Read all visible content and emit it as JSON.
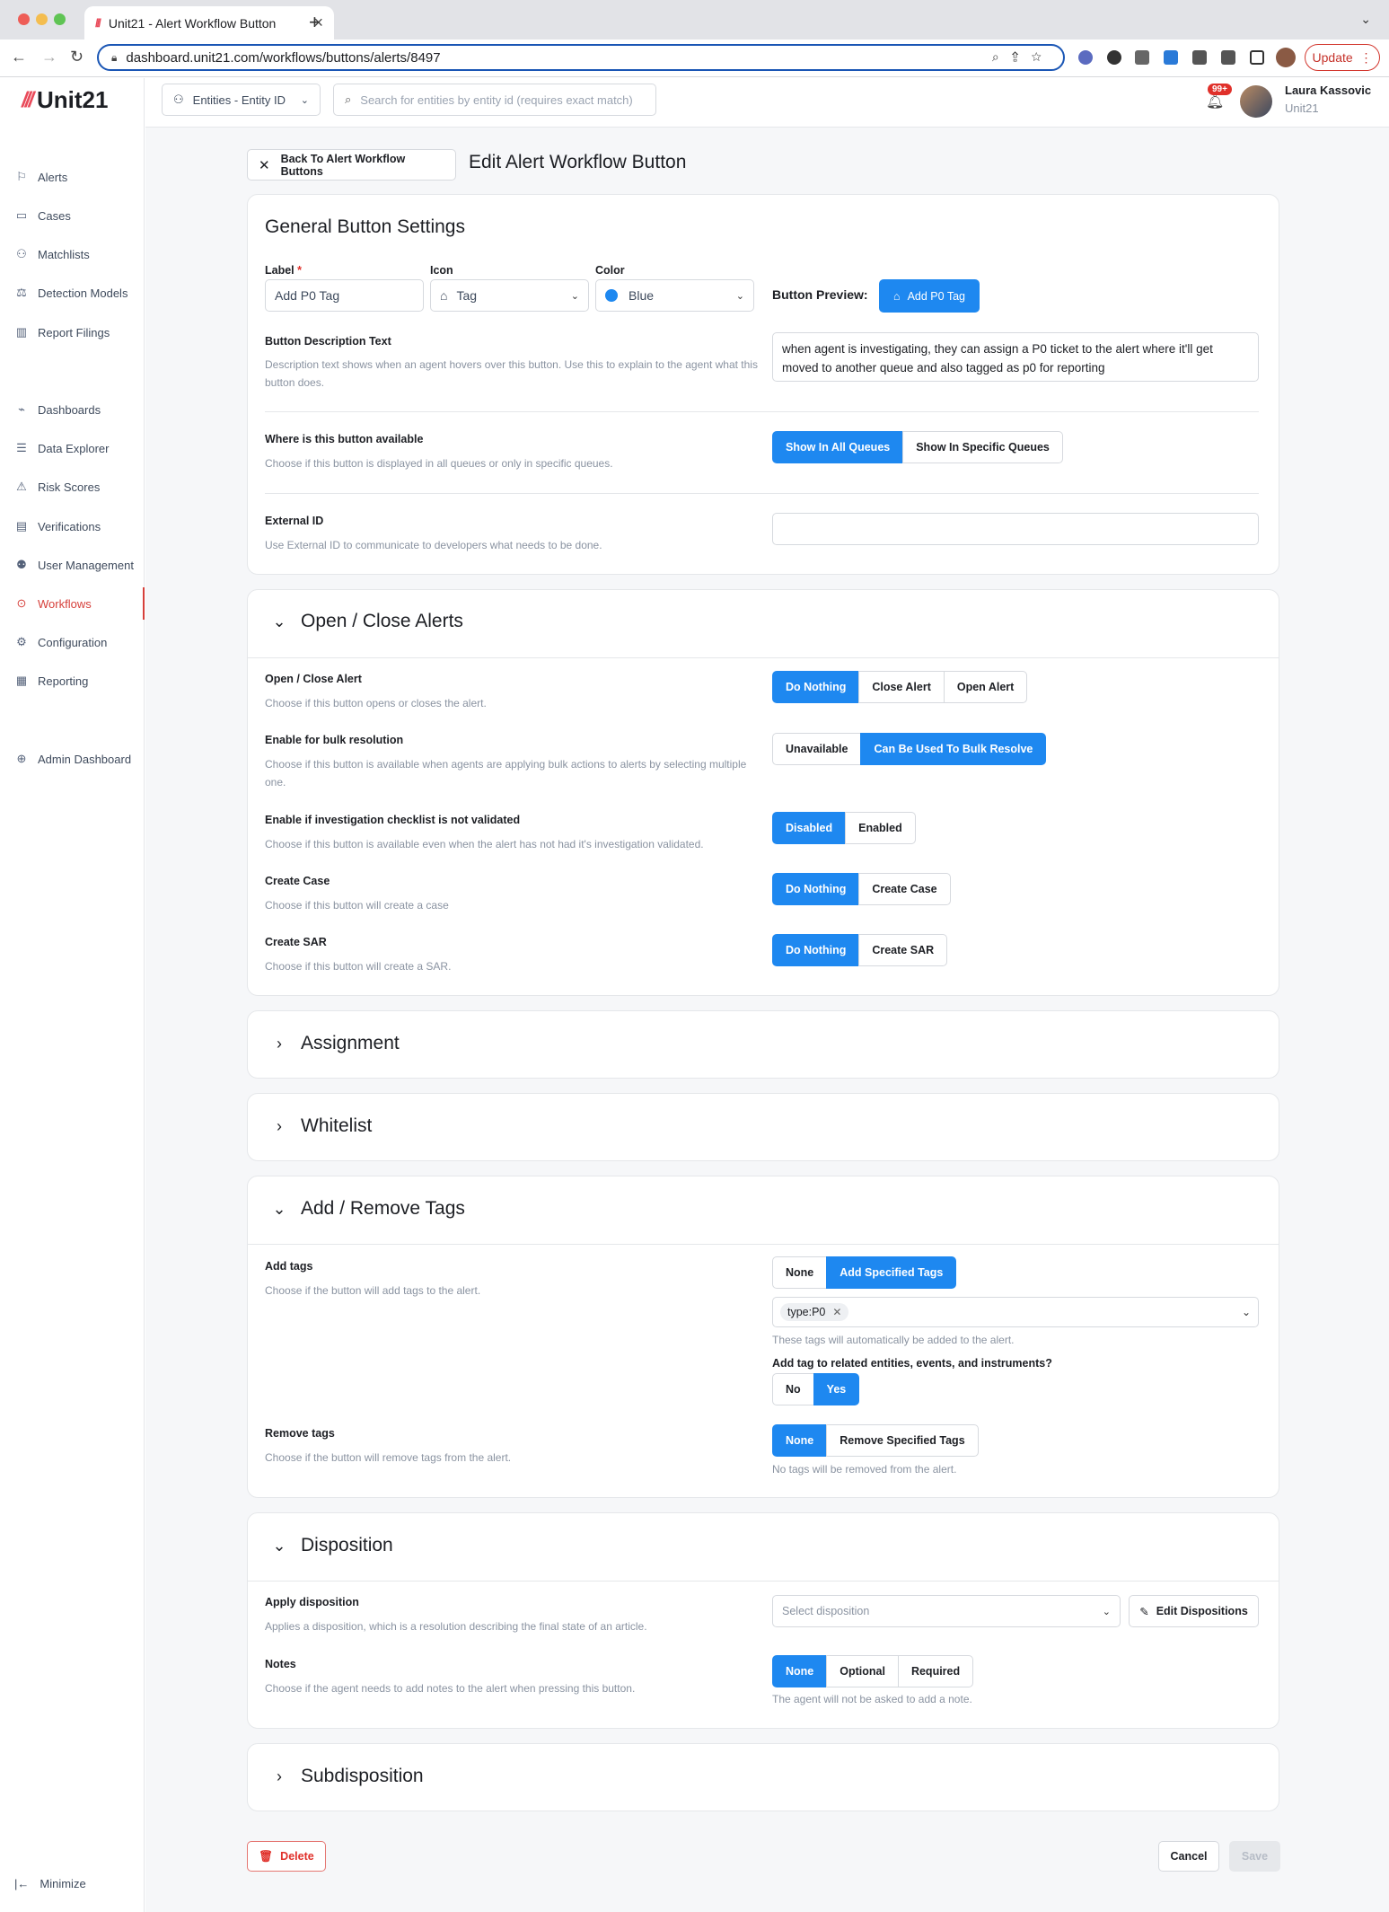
{
  "browser": {
    "tab_title": "Unit21 - Alert Workflow Button",
    "tab_icon": "///",
    "url": "dashboard.unit21.com/workflows/buttons/alerts/8497",
    "update_label": "Update"
  },
  "app": {
    "logo_mark": "///",
    "logo_text": "Unit21"
  },
  "sidebar": {
    "items": [
      {
        "label": "Alerts",
        "icon": "flag-icon"
      },
      {
        "label": "Cases",
        "icon": "briefcase-icon"
      },
      {
        "label": "Matchlists",
        "icon": "user-x-icon"
      },
      {
        "label": "Detection Models",
        "icon": "scale-icon"
      },
      {
        "label": "Report Filings",
        "icon": "building-icon"
      },
      {
        "label": "Dashboards",
        "icon": "chart-line-icon"
      },
      {
        "label": "Data Explorer",
        "icon": "search-list-icon"
      },
      {
        "label": "Risk Scores",
        "icon": "warning-icon"
      },
      {
        "label": "Verifications",
        "icon": "id-card-icon"
      },
      {
        "label": "User Management",
        "icon": "users-icon"
      },
      {
        "label": "Workflows",
        "icon": "play-circle-icon",
        "active": true
      },
      {
        "label": "Configuration",
        "icon": "gear-icon"
      },
      {
        "label": "Reporting",
        "icon": "report-icon"
      },
      {
        "label": "Admin Dashboard",
        "icon": "globe-icon"
      }
    ],
    "minimize_label": "Minimize"
  },
  "header": {
    "entity_select": "Entities - Entity ID",
    "search_placeholder": "Search for entities by entity id (requires exact match)",
    "notifications_badge": "99+",
    "user_name": "Laura Kassovic",
    "user_org": "Unit21"
  },
  "page": {
    "back_label": "Back To Alert Workflow Buttons",
    "title": "Edit Alert Workflow Button"
  },
  "general": {
    "title": "General Button Settings",
    "label_label": "Label",
    "label_required": "*",
    "label_value": "Add P0 Tag",
    "icon_label": "Icon",
    "icon_value": "Tag",
    "color_label": "Color",
    "color_value": "Blue",
    "color_hex": "#1e88f0",
    "preview_label": "Button Preview:",
    "preview_button": "Add P0 Tag",
    "desc_label": "Button Description Text",
    "desc_help": "Description text shows when an agent hovers over this button. Use this to explain to the agent what this button does.",
    "desc_value": "when agent is investigating, they can assign a P0 ticket to the alert where it'll get moved to another queue and also tagged as p0 for reporting",
    "avail_label": "Where is this button available",
    "avail_help": "Choose if this button is displayed in all queues or only in specific queues.",
    "avail_options": [
      "Show In All Queues",
      "Show In Specific Queues"
    ],
    "ext_label": "External ID",
    "ext_help": "Use External ID to communicate to developers what needs to be done.",
    "ext_value": ""
  },
  "open_close": {
    "title": "Open / Close Alerts",
    "rows": [
      {
        "label": "Open / Close Alert",
        "help": "Choose if this button opens or closes the alert.",
        "options": [
          "Do Nothing",
          "Close Alert",
          "Open Alert"
        ],
        "selected": 0
      },
      {
        "label": "Enable for bulk resolution",
        "help": "Choose if this button is available when agents are applying bulk actions to alerts by selecting multiple one.",
        "options": [
          "Unavailable",
          "Can Be Used To Bulk Resolve"
        ],
        "selected": 1
      },
      {
        "label": "Enable if investigation checklist is not validated",
        "help": "Choose if this button is available even when the alert has not had it's investigation validated.",
        "options": [
          "Disabled",
          "Enabled"
        ],
        "selected": 0
      },
      {
        "label": "Create Case",
        "help": "Choose if this button will create a case",
        "options": [
          "Do Nothing",
          "Create Case"
        ],
        "selected": 0
      },
      {
        "label": "Create SAR",
        "help": "Choose if this button will create a SAR.",
        "options": [
          "Do Nothing",
          "Create SAR"
        ],
        "selected": 0
      }
    ]
  },
  "assignment": {
    "title": "Assignment"
  },
  "whitelist": {
    "title": "Whitelist"
  },
  "tags": {
    "title": "Add / Remove Tags",
    "add_label": "Add tags",
    "add_help": "Choose if the button will add tags to the alert.",
    "add_options": [
      "None",
      "Add Specified Tags"
    ],
    "tag_chip": "type:P0",
    "add_hint": "These tags will automatically be added to the alert.",
    "related_label": "Add tag to related entities, events, and instruments?",
    "related_options": [
      "No",
      "Yes"
    ],
    "remove_label": "Remove tags",
    "remove_help": "Choose if the button will remove tags from the alert.",
    "remove_options": [
      "None",
      "Remove Specified Tags"
    ],
    "remove_hint": "No tags will be removed from the alert."
  },
  "disposition": {
    "title": "Disposition",
    "apply_label": "Apply disposition",
    "apply_help": "Applies a disposition, which is a resolution describing the final state of an article.",
    "select_placeholder": "Select disposition",
    "edit_label": "Edit Dispositions",
    "notes_label": "Notes",
    "notes_help": "Choose if the agent needs to add notes to the alert when pressing this button.",
    "notes_options": [
      "None",
      "Optional",
      "Required"
    ],
    "notes_hint": "The agent will not be asked to add a note."
  },
  "subdisposition": {
    "title": "Subdisposition"
  },
  "footer": {
    "delete_label": "Delete",
    "cancel_label": "Cancel",
    "save_label": "Save"
  }
}
